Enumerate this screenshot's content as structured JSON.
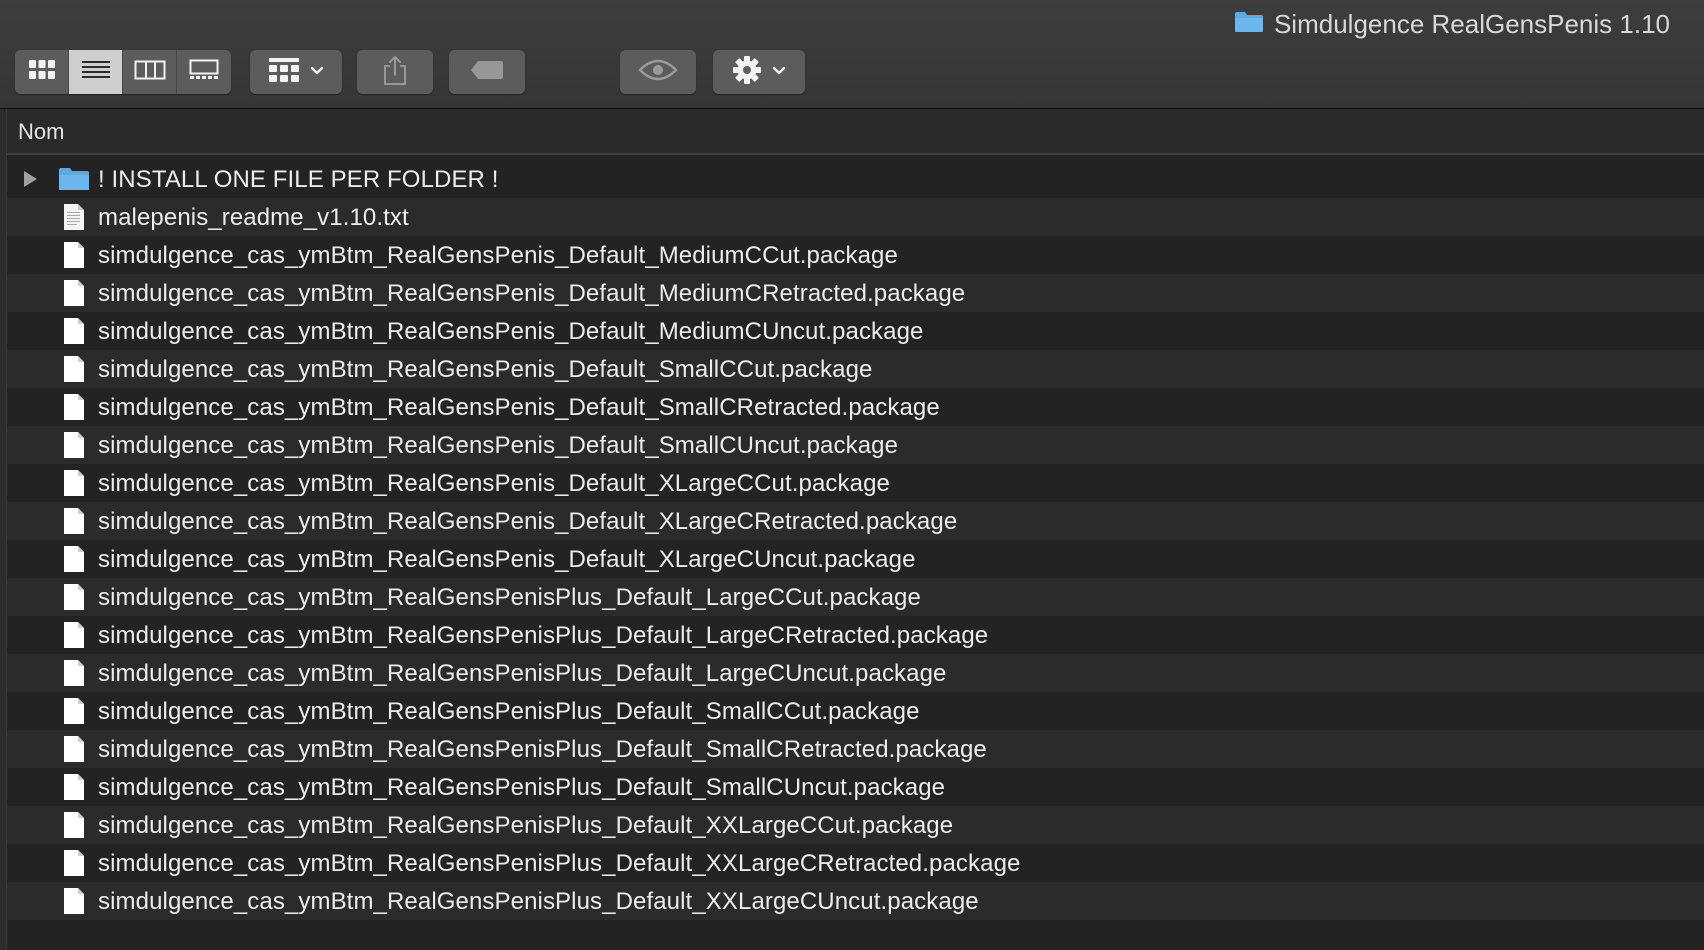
{
  "window": {
    "title": "Simdulgence RealGensPenis 1.10"
  },
  "toolbar": {
    "view_buttons": [
      {
        "name": "icon-view",
        "active": false
      },
      {
        "name": "list-view",
        "active": true
      },
      {
        "name": "column-view",
        "active": false
      },
      {
        "name": "gallery-view",
        "active": false
      }
    ],
    "group_by_icon": "grid-icon",
    "share_icon": "share-icon",
    "tag_icon": "tag-icon",
    "quicklook_icon": "eye-icon",
    "action_icon": "gear-icon"
  },
  "columns": {
    "name_header": "Nom"
  },
  "files": [
    {
      "name": "! INSTALL ONE FILE PER FOLDER !",
      "kind": "folder",
      "expandable": true
    },
    {
      "name": "malepenis_readme_v1.10.txt",
      "kind": "text"
    },
    {
      "name": "simdulgence_cas_ymBtm_RealGensPenis_Default_MediumCCut.package",
      "kind": "file"
    },
    {
      "name": "simdulgence_cas_ymBtm_RealGensPenis_Default_MediumCRetracted.package",
      "kind": "file"
    },
    {
      "name": "simdulgence_cas_ymBtm_RealGensPenis_Default_MediumCUncut.package",
      "kind": "file"
    },
    {
      "name": "simdulgence_cas_ymBtm_RealGensPenis_Default_SmallCCut.package",
      "kind": "file"
    },
    {
      "name": "simdulgence_cas_ymBtm_RealGensPenis_Default_SmallCRetracted.package",
      "kind": "file"
    },
    {
      "name": "simdulgence_cas_ymBtm_RealGensPenis_Default_SmallCUncut.package",
      "kind": "file"
    },
    {
      "name": "simdulgence_cas_ymBtm_RealGensPenis_Default_XLargeCCut.package",
      "kind": "file"
    },
    {
      "name": "simdulgence_cas_ymBtm_RealGensPenis_Default_XLargeCRetracted.package",
      "kind": "file"
    },
    {
      "name": "simdulgence_cas_ymBtm_RealGensPenis_Default_XLargeCUncut.package",
      "kind": "file"
    },
    {
      "name": "simdulgence_cas_ymBtm_RealGensPenisPlus_Default_LargeCCut.package",
      "kind": "file"
    },
    {
      "name": "simdulgence_cas_ymBtm_RealGensPenisPlus_Default_LargeCRetracted.package",
      "kind": "file"
    },
    {
      "name": "simdulgence_cas_ymBtm_RealGensPenisPlus_Default_LargeCUncut.package",
      "kind": "file"
    },
    {
      "name": "simdulgence_cas_ymBtm_RealGensPenisPlus_Default_SmallCCut.package",
      "kind": "file"
    },
    {
      "name": "simdulgence_cas_ymBtm_RealGensPenisPlus_Default_SmallCRetracted.package",
      "kind": "file"
    },
    {
      "name": "simdulgence_cas_ymBtm_RealGensPenisPlus_Default_SmallCUncut.package",
      "kind": "file"
    },
    {
      "name": "simdulgence_cas_ymBtm_RealGensPenisPlus_Default_XXLargeCCut.package",
      "kind": "file"
    },
    {
      "name": "simdulgence_cas_ymBtm_RealGensPenisPlus_Default_XXLargeCRetracted.package",
      "kind": "file"
    },
    {
      "name": "simdulgence_cas_ymBtm_RealGensPenisPlus_Default_XXLargeCUncut.package",
      "kind": "file"
    }
  ],
  "colors": {
    "folder_blue": "#5fa8e0",
    "text": "#ececec",
    "row_even": "#2b2b2b",
    "row_odd": "#232323"
  }
}
